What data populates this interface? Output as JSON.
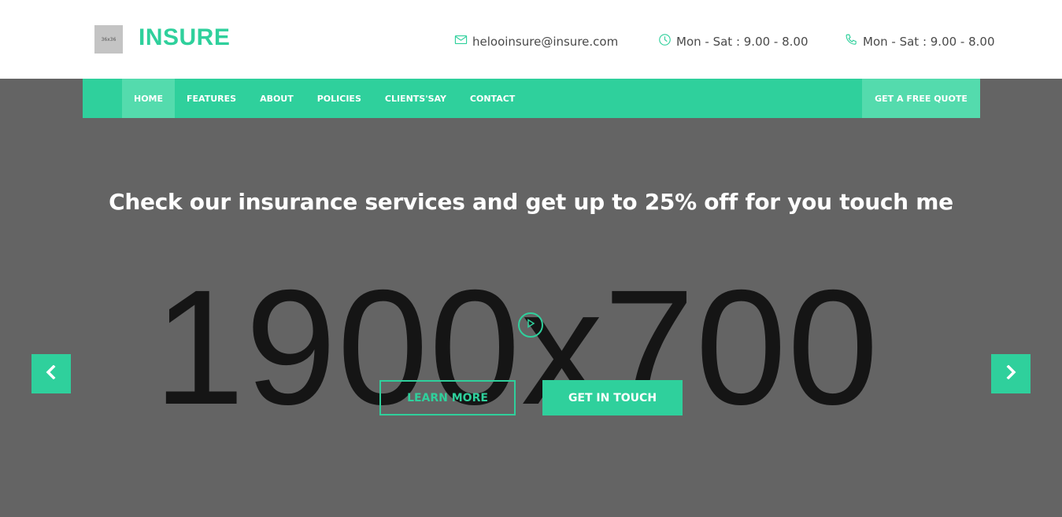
{
  "header": {
    "logo_placeholder": "36x36",
    "brand": "INSURE",
    "email": "helooinsure@insure.com",
    "hours": "Mon - Sat : 9.00 - 8.00",
    "phone": "Mon - Sat : 9.00 - 8.00"
  },
  "nav": {
    "items": [
      "HOME",
      "FEATURES",
      "ABOUT",
      "POLICIES",
      "CLIENTS'SAY",
      "CONTACT"
    ],
    "active": "HOME",
    "quote_label": "GET A FREE QUOTE"
  },
  "hero": {
    "placeholder": "1900x700",
    "headline": "Check our insurance services and get up to 25% off for you touch me",
    "learn_more": "LEARN MORE",
    "get_in_touch": "GET IN TOUCH"
  },
  "colors": {
    "accent": "#2fd09c",
    "accent_light": "#54dbad",
    "hero_bg": "#646464"
  },
  "icons": [
    "envelope-icon",
    "clock-icon",
    "phone-icon",
    "play-icon",
    "chevron-left-icon",
    "chevron-right-icon"
  ]
}
